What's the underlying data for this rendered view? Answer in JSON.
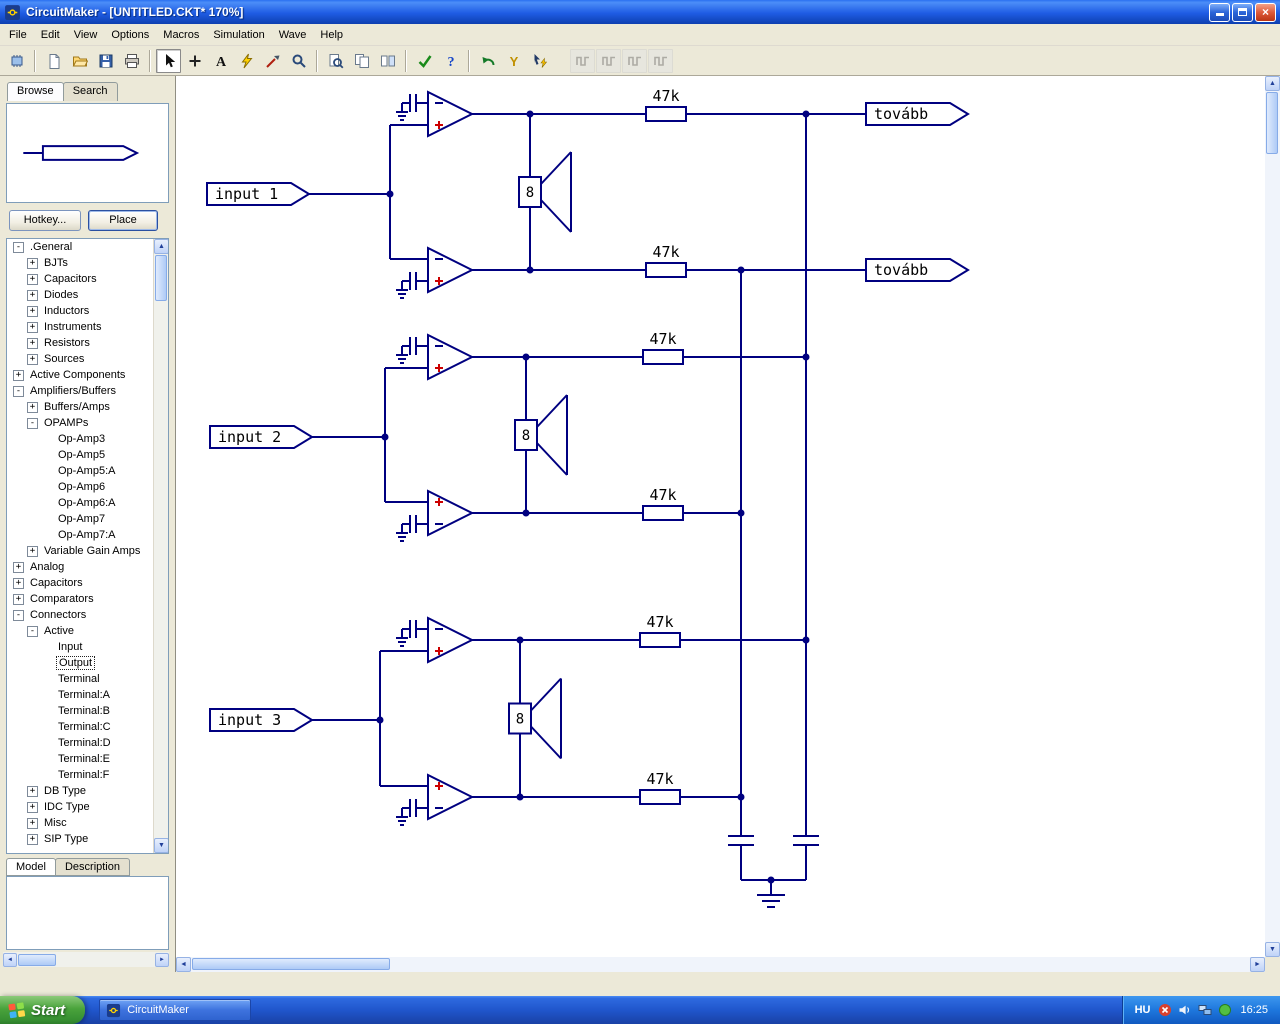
{
  "window": {
    "title": "CircuitMaker - [UNTITLED.CKT* 170%]"
  },
  "menu": {
    "items": [
      "File",
      "Edit",
      "View",
      "Options",
      "Macros",
      "Simulation",
      "Wave",
      "Help"
    ]
  },
  "toolbar": {
    "buttons": [
      {
        "name": "component-browser",
        "icon": "board-icon"
      },
      {
        "sep": true
      },
      {
        "name": "new-file",
        "icon": "new-file-icon"
      },
      {
        "name": "open-file",
        "icon": "open-folder-icon"
      },
      {
        "name": "save-file",
        "icon": "save-icon"
      },
      {
        "name": "print",
        "icon": "printer-icon"
      },
      {
        "sep": true
      },
      {
        "name": "select-tool",
        "icon": "cursor-icon",
        "pressed": true
      },
      {
        "name": "wire-tool",
        "icon": "plus-icon"
      },
      {
        "name": "text-tool",
        "icon": "text-a-icon"
      },
      {
        "name": "run-simulation",
        "icon": "lightning-icon"
      },
      {
        "name": "probe-tool",
        "icon": "probe-icon"
      },
      {
        "name": "zoom-tool",
        "icon": "magnifier-icon"
      },
      {
        "sep": true
      },
      {
        "name": "zoom-page",
        "icon": "magnifier-page-icon"
      },
      {
        "name": "copy-page",
        "icon": "copy-icon"
      },
      {
        "name": "split-view",
        "icon": "split-icon"
      },
      {
        "sep": true
      },
      {
        "name": "design-check",
        "icon": "check-icon"
      },
      {
        "name": "help",
        "icon": "question-icon"
      },
      {
        "sep": true
      },
      {
        "name": "undo",
        "icon": "undo-arrow-icon"
      },
      {
        "name": "waveform-probe",
        "icon": "y-probe-icon"
      },
      {
        "name": "auto-wire",
        "icon": "cursor-bolt-icon"
      },
      {
        "gap": true
      },
      {
        "name": "scope-1",
        "icon": "waveform-icon",
        "disabled": true
      },
      {
        "name": "scope-2",
        "icon": "waveform-icon",
        "disabled": true
      },
      {
        "name": "scope-3",
        "icon": "waveform-icon",
        "disabled": true
      },
      {
        "name": "scope-4",
        "icon": "waveform-icon",
        "disabled": true
      }
    ]
  },
  "sidebar": {
    "tabs": [
      {
        "label": "Browse",
        "active": true
      },
      {
        "label": "Search",
        "active": false
      }
    ],
    "hotkey_button": "Hotkey...",
    "place_button": "Place",
    "tree": [
      {
        "label": ".General",
        "level": 0,
        "glyph": "-"
      },
      {
        "label": "BJTs",
        "level": 1,
        "glyph": "+"
      },
      {
        "label": "Capacitors",
        "level": 1,
        "glyph": "+"
      },
      {
        "label": "Diodes",
        "level": 1,
        "glyph": "+"
      },
      {
        "label": "Inductors",
        "level": 1,
        "glyph": "+"
      },
      {
        "label": "Instruments",
        "level": 1,
        "glyph": "+"
      },
      {
        "label": "Resistors",
        "level": 1,
        "glyph": "+"
      },
      {
        "label": "Sources",
        "level": 1,
        "glyph": "+"
      },
      {
        "label": "Active Components",
        "level": 0,
        "glyph": "+"
      },
      {
        "label": "Amplifiers/Buffers",
        "level": 0,
        "glyph": "-"
      },
      {
        "label": "Buffers/Amps",
        "level": 1,
        "glyph": "+"
      },
      {
        "label": "OPAMPs",
        "level": 1,
        "glyph": "-"
      },
      {
        "label": "Op-Amp3",
        "level": 2,
        "glyph": ""
      },
      {
        "label": "Op-Amp5",
        "level": 2,
        "glyph": ""
      },
      {
        "label": "Op-Amp5:A",
        "level": 2,
        "glyph": ""
      },
      {
        "label": "Op-Amp6",
        "level": 2,
        "glyph": ""
      },
      {
        "label": "Op-Amp6:A",
        "level": 2,
        "glyph": ""
      },
      {
        "label": "Op-Amp7",
        "level": 2,
        "glyph": ""
      },
      {
        "label": "Op-Amp7:A",
        "level": 2,
        "glyph": ""
      },
      {
        "label": "Variable Gain Amps",
        "level": 1,
        "glyph": "+"
      },
      {
        "label": "Analog",
        "level": 0,
        "glyph": "+"
      },
      {
        "label": "Capacitors",
        "level": 0,
        "glyph": "+"
      },
      {
        "label": "Comparators",
        "level": 0,
        "glyph": "+"
      },
      {
        "label": "Connectors",
        "level": 0,
        "glyph": "-"
      },
      {
        "label": "Active",
        "level": 1,
        "glyph": "-"
      },
      {
        "label": "Input",
        "level": 2,
        "glyph": ""
      },
      {
        "label": "Output",
        "level": 2,
        "glyph": "",
        "selected": true
      },
      {
        "label": "Terminal",
        "level": 2,
        "glyph": ""
      },
      {
        "label": "Terminal:A",
        "level": 2,
        "glyph": ""
      },
      {
        "label": "Terminal:B",
        "level": 2,
        "glyph": ""
      },
      {
        "label": "Terminal:C",
        "level": 2,
        "glyph": ""
      },
      {
        "label": "Terminal:D",
        "level": 2,
        "glyph": ""
      },
      {
        "label": "Terminal:E",
        "level": 2,
        "glyph": ""
      },
      {
        "label": "Terminal:F",
        "level": 2,
        "glyph": ""
      },
      {
        "label": "DB Type",
        "level": 1,
        "glyph": "+"
      },
      {
        "label": "IDC Type",
        "level": 1,
        "glyph": "+"
      },
      {
        "label": "Misc",
        "level": 1,
        "glyph": "+"
      },
      {
        "label": "SIP Type",
        "level": 1,
        "glyph": "+"
      }
    ],
    "bottom_tabs": [
      "Model",
      "Description"
    ]
  },
  "circuit": {
    "inputs": [
      "input 1",
      "input 2",
      "input 3"
    ],
    "outputs": [
      "tovább",
      "tovább"
    ],
    "resistors": [
      "47k",
      "47k",
      "47k",
      "47k",
      "47k",
      "47k"
    ],
    "speakers": [
      "8",
      "8",
      "8"
    ],
    "colors": {
      "wire": "#000080",
      "plus": "#cc0000"
    }
  },
  "taskbar": {
    "start_label": "Start",
    "app_button": "CircuitMaker",
    "language": "HU",
    "time": "16:25",
    "tray_icons": [
      "security-icon",
      "volume-icon",
      "network-icon",
      "status-icon"
    ]
  }
}
